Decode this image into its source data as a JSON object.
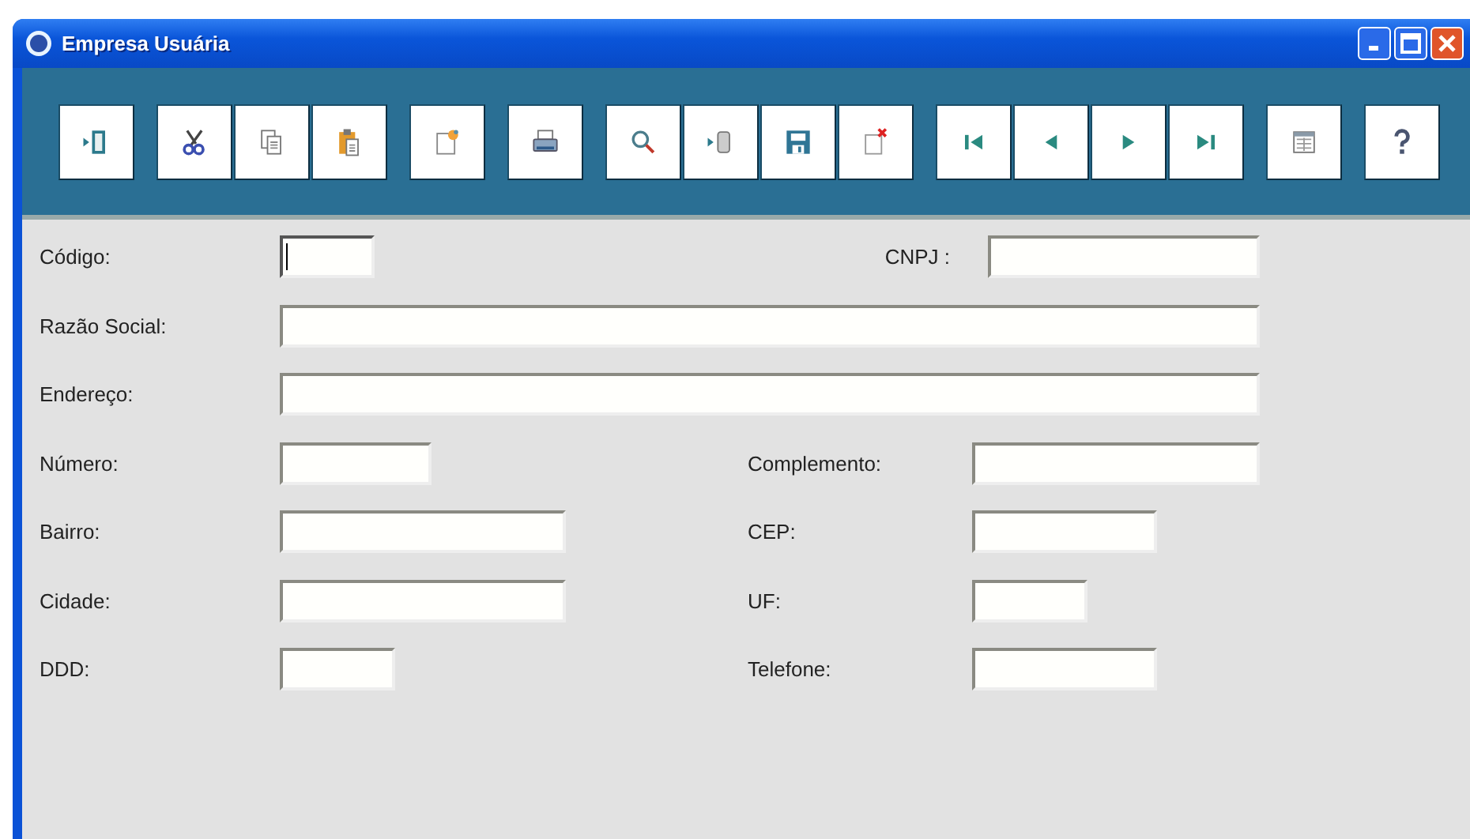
{
  "window": {
    "title": "Empresa Usuária"
  },
  "toolbar": {
    "groups": [
      [
        {
          "kind": "exit"
        }
      ],
      [
        {
          "kind": "cut"
        },
        {
          "kind": "copy"
        },
        {
          "kind": "paste"
        }
      ],
      [
        {
          "kind": "new"
        }
      ],
      [
        {
          "kind": "print"
        }
      ],
      [
        {
          "kind": "search"
        },
        {
          "kind": "import"
        },
        {
          "kind": "save"
        },
        {
          "kind": "delete"
        }
      ],
      [
        {
          "kind": "first"
        },
        {
          "kind": "previous"
        },
        {
          "kind": "next"
        },
        {
          "kind": "last"
        }
      ],
      [
        {
          "kind": "grid"
        }
      ],
      [
        {
          "kind": "help"
        }
      ]
    ]
  },
  "form": {
    "rows": [
      {
        "left": {
          "label": "Código:",
          "focused": true
        },
        "right": {
          "label": "CNPJ :"
        }
      },
      {
        "left": {
          "label": "Razão Social:",
          "focused": false
        }
      },
      {
        "left": {
          "label": "Endereço:",
          "focused": false
        }
      },
      {
        "left": {
          "label": "Número:",
          "focused": false
        },
        "right": {
          "label": "Complemento:"
        }
      },
      {
        "left": {
          "label": "Bairro:",
          "focused": false
        },
        "right": {
          "label": "CEP:"
        }
      },
      {
        "left": {
          "label": "Cidade:",
          "focused": false
        },
        "right": {
          "label": "UF:"
        }
      },
      {
        "left": {
          "label": "DDD:",
          "focused": false
        },
        "right": {
          "label": "Telefone:"
        }
      }
    ]
  }
}
